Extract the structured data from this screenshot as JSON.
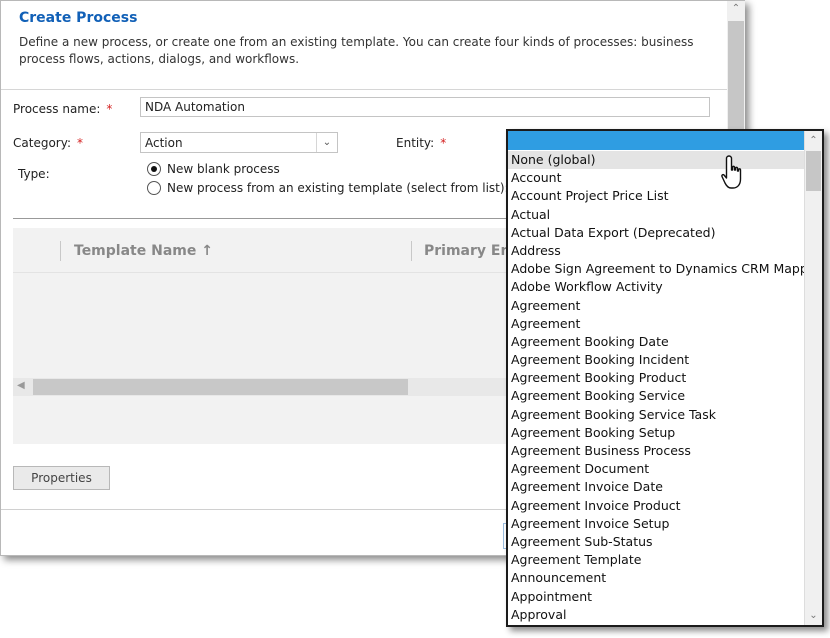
{
  "dialog": {
    "title": "Create Process",
    "description": "Define a new process, or create one from an existing template. You can create four kinds of processes: business process flows, actions, dialogs, and workflows."
  },
  "form": {
    "process_name_label": "Process name:",
    "process_name_value": "NDA Automation",
    "category_label": "Category:",
    "category_value": "Action",
    "entity_label": "Entity:",
    "required_marker": "*",
    "type_label": "Type:",
    "type_options": [
      {
        "label": "New blank process",
        "selected": true
      },
      {
        "label": "New process from an existing template (select from list):",
        "selected": false
      }
    ]
  },
  "grid": {
    "columns": [
      "Template Name ↑",
      "Primary Enti"
    ]
  },
  "buttons": {
    "properties": "Properties"
  },
  "entity_dropdown": {
    "hover_index": 0,
    "accent_color": "#2f9de2",
    "items": [
      "None (global)",
      "Account",
      "Account Project Price List",
      "Actual",
      "Actual Data Export (Deprecated)",
      "Address",
      "Adobe Sign Agreement to Dynamics CRM Mapping",
      "Adobe Workflow Activity",
      "Agreement",
      "Agreement",
      "Agreement Booking Date",
      "Agreement Booking Incident",
      "Agreement Booking Product",
      "Agreement Booking Service",
      "Agreement Booking Service Task",
      "Agreement Booking Setup",
      "Agreement Business Process",
      "Agreement Document",
      "Agreement Invoice Date",
      "Agreement Invoice Product",
      "Agreement Invoice Setup",
      "Agreement Sub-Status",
      "Agreement Template",
      "Announcement",
      "Appointment",
      "Approval"
    ]
  },
  "icons": {
    "cursor": "hand-pointer-icon",
    "select_chevron": "chevron-down-icon",
    "scroll_up": "scroll-up-icon",
    "scroll_down": "scroll-down-icon",
    "scroll_left": "scroll-left-icon"
  }
}
